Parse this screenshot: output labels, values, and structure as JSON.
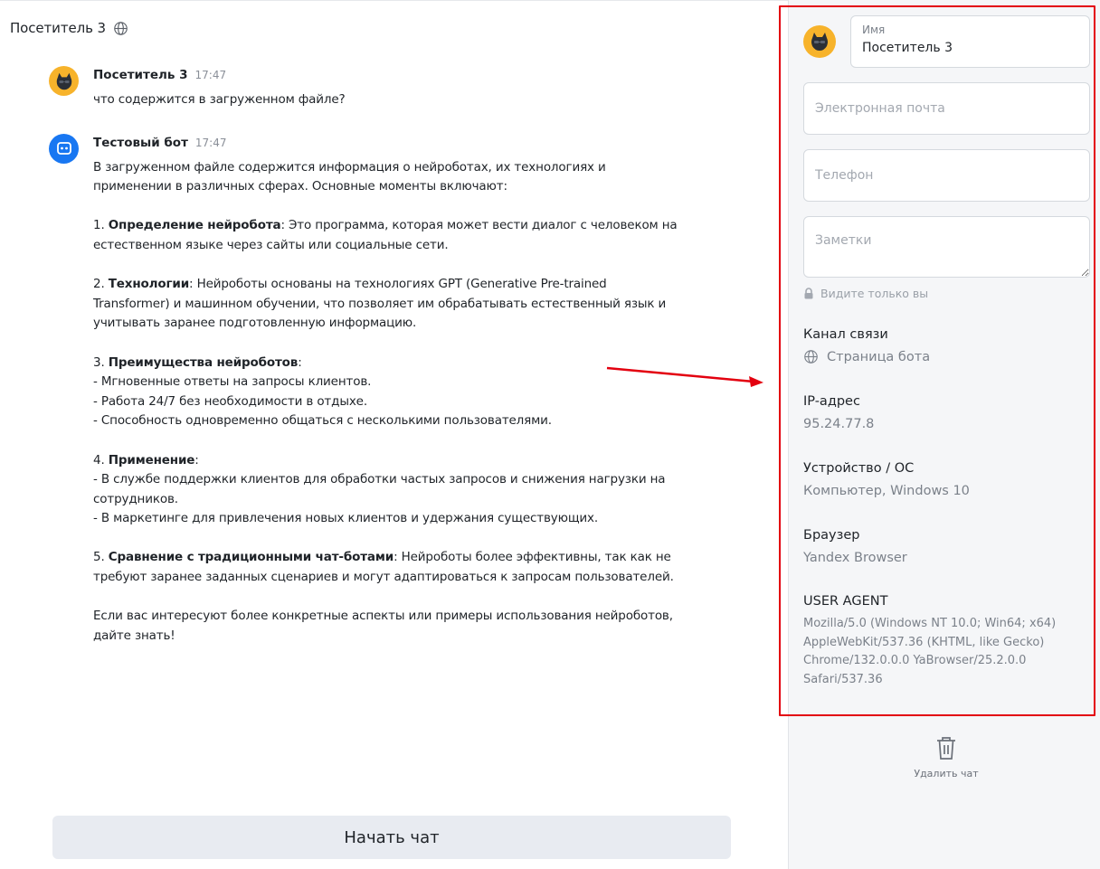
{
  "chat": {
    "title": "Посетитель 3",
    "messages": [
      {
        "author": "Посетитель 3",
        "time": "17:47",
        "avatar": "cat-avatar-icon",
        "paragraphs": [
          {
            "text": "что содержится в загруженном файле?"
          }
        ]
      },
      {
        "author": "Тестовый бот",
        "time": "17:47",
        "avatar": "bot-avatar-icon",
        "paragraphs": [
          {
            "text": "В загруженном файле содержится информация о нейроботах, их технологиях и применении в различных сферах. Основные моменты включают:"
          },
          {
            "text": ""
          },
          {
            "prefix": "1. ",
            "bold": "Определение нейробота",
            "text": ": Это программа, которая может вести диалог с человеком на естественном языке через сайты или социальные сети."
          },
          {
            "text": ""
          },
          {
            "prefix": "2. ",
            "bold": "Технологии",
            "text": ": Нейроботы основаны на технологиях GPT (Generative Pre-trained Transformer) и машинном обучении, что позволяет им обрабатывать естественный язык и учитывать заранее подготовленную информацию."
          },
          {
            "text": ""
          },
          {
            "prefix": "3. ",
            "bold": "Преимущества нейроботов",
            "text": ":"
          },
          {
            "text": "- Мгновенные ответы на запросы клиентов."
          },
          {
            "text": "- Работа 24/7 без необходимости в отдыхе."
          },
          {
            "text": "- Способность одновременно общаться с несколькими пользователями."
          },
          {
            "text": ""
          },
          {
            "prefix": "4. ",
            "bold": "Применение",
            "text": ":"
          },
          {
            "text": "- В службе поддержки клиентов для обработки частых запросов и снижения нагрузки на сотрудников."
          },
          {
            "text": "- В маркетинге для привлечения новых клиентов и удержания существующих."
          },
          {
            "text": ""
          },
          {
            "prefix": "5. ",
            "bold": "Сравнение с традиционными чат-ботами",
            "text": ": Нейроботы более эффективны, так как не требуют заранее заданных сценариев и могут адаптироваться к запросам пользователей."
          },
          {
            "text": ""
          },
          {
            "text": "Если вас интересуют более конкретные аспекты или примеры использования нейроботов, дайте знать!"
          }
        ]
      }
    ],
    "start_chat_label": "Начать чат"
  },
  "panel": {
    "name_label": "Имя",
    "name_value": "Посетитель 3",
    "email_placeholder": "Электронная почта",
    "phone_placeholder": "Телефон",
    "notes_placeholder": "Заметки",
    "private_note": "Видите только вы",
    "channel_label": "Канал связи",
    "channel_value": "Страница бота",
    "ip_label": "IP-адрес",
    "ip_value": "95.24.77.8",
    "device_label": "Устройство / ОС",
    "device_value": "Компьютер, Windows 10",
    "browser_label": "Браузер",
    "browser_value": "Yandex Browser",
    "ua_label": "USER AGENT",
    "ua_value": "Mozilla/5.0 (Windows NT 10.0; Win64; x64) AppleWebKit/537.36 (KHTML, like Gecko) Chrome/132.0.0.0 YaBrowser/25.2.0.0 Safari/537.36",
    "delete_label": "Удалить чат"
  },
  "colors": {
    "highlight": "#e3000f",
    "visitor_avatar": "#f7b32b",
    "bot_avatar": "#1877f2",
    "start_button_bg": "#e8ebf1"
  }
}
